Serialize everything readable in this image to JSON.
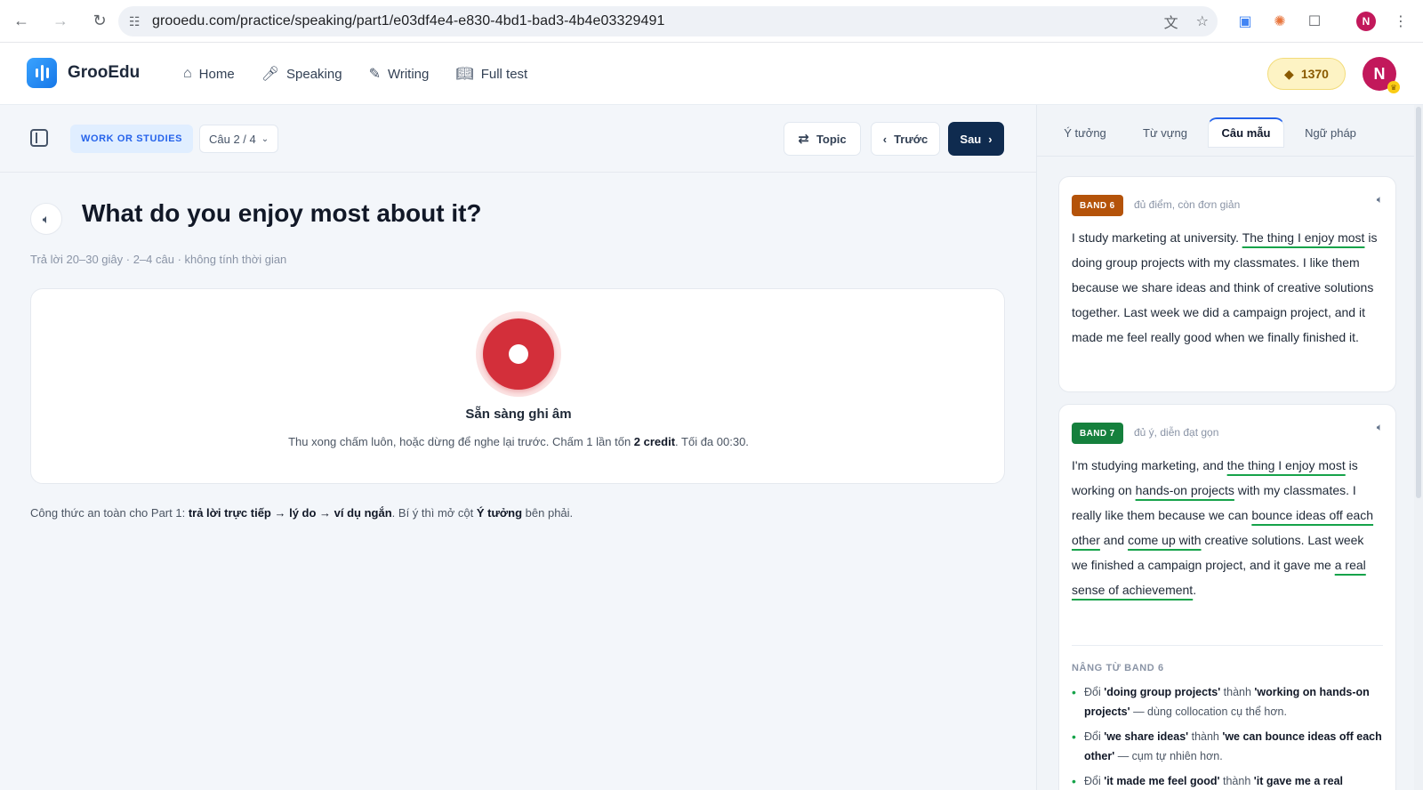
{
  "browser": {
    "url": "grooedu.com/practice/speaking/part1/e03df4e4-e830-4bd1-bad3-4b4e03329491",
    "profile_initial": "N"
  },
  "header": {
    "brand": "GrooEdu",
    "nav": [
      {
        "label": "Home",
        "icon": "home-icon"
      },
      {
        "label": "Speaking",
        "icon": "mic-icon"
      },
      {
        "label": "Writing",
        "icon": "pencil-icon"
      },
      {
        "label": "Full test",
        "icon": "book-icon"
      }
    ],
    "credits": "1370",
    "user_initial": "N"
  },
  "toolbar": {
    "topic_chip": "WORK OR STUDIES",
    "question_select": "Câu 2 / 4",
    "topic_button": "Topic",
    "prev_button": "Trước",
    "next_button": "Sau"
  },
  "question": {
    "title": "What do you enjoy most about it?",
    "hint": "Trả lời 20–30 giây · 2–4 câu · không tính thời gian"
  },
  "recorder": {
    "title": "Sẵn sàng ghi âm",
    "sub_before": "Thu xong chấm luôn, hoặc dừng để nghe lại trước. Chấm 1 lần tốn ",
    "sub_bold": "2 credit",
    "sub_after": ". Tối đa 00:30."
  },
  "formula": {
    "before": "Công thức an toàn cho Part 1: ",
    "bold": "trả lời trực tiếp → lý do → ví dụ ngắn",
    "middle": ". Bí ý thì mở cột ",
    "bold2": "Ý tưởng",
    "after": " bên phải."
  },
  "right_panel": {
    "tabs": [
      "Ý tưởng",
      "Từ vựng",
      "Câu mẫu",
      "Ngữ pháp"
    ],
    "active_tab": "Câu mẫu",
    "band6": {
      "badge": "BAND 6",
      "note": "đủ điểm, còn đơn giản",
      "t1": "I study marketing at university. ",
      "h1": "The thing I enjoy most",
      "t2": " is doing group projects with my classmates. I like them because we share ideas and think of creative solutions together. Last week we did a campaign project, and it made me feel really good when we finally finished it."
    },
    "band7": {
      "badge": "BAND 7",
      "note": "đủ ý, diễn đạt gọn",
      "t1": "I'm studying marketing, and ",
      "h1": "the thing I enjoy most",
      "t2": " is working on ",
      "h2": "hands-on projects",
      "t3": " with my classmates. I really like them because we can ",
      "h3": "bounce ideas off each other",
      "t4": " and ",
      "h4": "come up with",
      "t5": " creative solutions. Last week we finished a campaign project, and it gave me ",
      "h5": "a real sense of achievement",
      "t6": "."
    },
    "upgrade_title": "NÂNG TỪ BAND 6",
    "upgrades": [
      {
        "pre": "Đổi ",
        "from": "'doing group projects'",
        "mid": " thành ",
        "to": "'working on hands-on projects'",
        "post": " — dùng collocation cụ thể hơn."
      },
      {
        "pre": "Đổi ",
        "from": "'we share ideas'",
        "mid": " thành ",
        "to": "'we can bounce ideas off each other'",
        "post": " — cụm tự nhiên hơn."
      },
      {
        "pre": "Đổi ",
        "from": "'it made me feel good'",
        "mid": " thành ",
        "to": "'it gave me a real",
        "post": ""
      }
    ]
  }
}
